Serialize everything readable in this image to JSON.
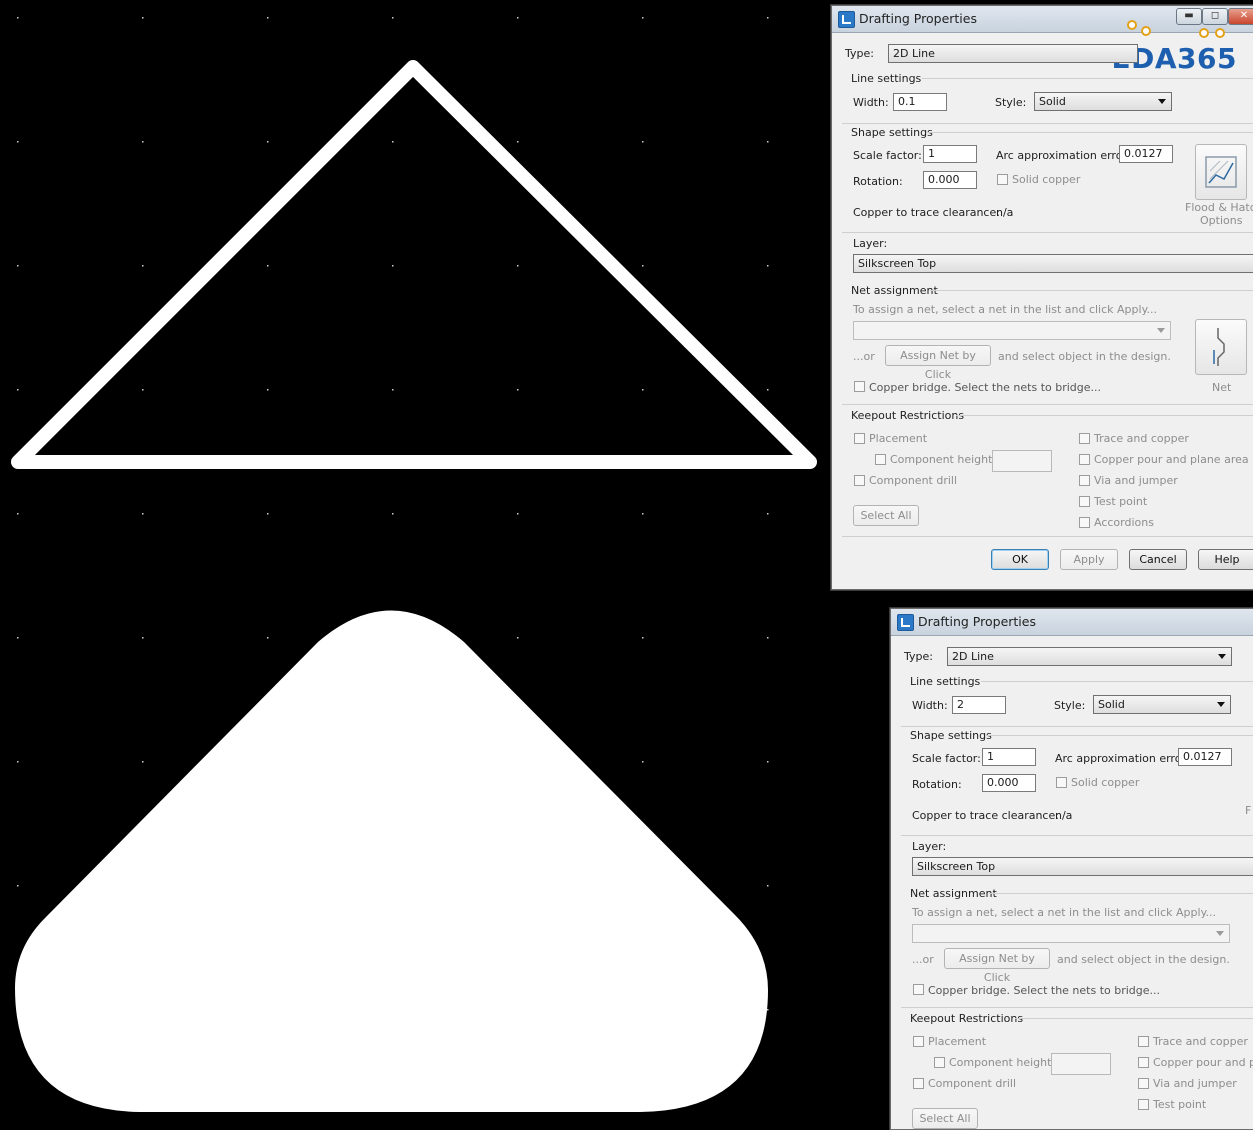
{
  "dialog_top": {
    "title": "Drafting Properties",
    "logo_text": "EDA365",
    "window_buttons": {
      "minimize": "▬",
      "maximize": "◻",
      "close": "✕"
    },
    "type_label": "Type:",
    "type_value": "2D Line",
    "line_settings": "Line settings",
    "width_label": "Width:",
    "width_value": "0.1",
    "style_label": "Style:",
    "style_value": "Solid",
    "shape_settings": "Shape settings",
    "scale_label": "Scale factor:",
    "scale_value": "1",
    "arc_label": "Arc approximation error:",
    "arc_value": "0.0127",
    "rotation_label": "Rotation:",
    "rotation_value": "0.000",
    "solid_copper": "Solid copper",
    "clearance_label": "Copper to trace clearance:",
    "clearance_value": "n/a",
    "flood_hatch_1": "Flood & Hatch",
    "flood_hatch_2": "Options",
    "layer_label": "Layer:",
    "layer_value": "Silkscreen Top",
    "net_assignment": "Net assignment",
    "net_hint": "To assign a net, select a net in the list and click Apply...",
    "or_text": "...or",
    "assign_net_button": "Assign Net by Click",
    "select_object_text": "and select object in the design.",
    "copper_bridge": "Copper bridge. Select the nets to bridge...",
    "net_label": "Net",
    "keepout": "Keepout Restrictions",
    "placement": "Placement",
    "component_height": "Component height",
    "component_drill": "Component drill",
    "trace_copper": "Trace and copper",
    "copper_pour": "Copper pour and plane area",
    "via_jumper": "Via and jumper",
    "test_point": "Test point",
    "accordions": "Accordions",
    "select_all": "Select All",
    "ok": "OK",
    "apply": "Apply",
    "cancel": "Cancel",
    "help": "Help"
  },
  "dialog_bottom": {
    "title": "Drafting Properties",
    "type_label": "Type:",
    "type_value": "2D Line",
    "line_settings": "Line settings",
    "width_label": "Width:",
    "width_value": "2",
    "style_label": "Style:",
    "style_value": "Solid",
    "shape_settings": "Shape settings",
    "scale_label": "Scale factor:",
    "scale_value": "1",
    "arc_label": "Arc approximation error:",
    "arc_value": "0.0127",
    "rotation_label": "Rotation:",
    "rotation_value": "0.000",
    "solid_copper": "Solid copper",
    "clearance_label": "Copper to trace clearance:",
    "clearance_value": "n/a",
    "side_letter": "F",
    "layer_label": "Layer:",
    "layer_value": "Silkscreen Top",
    "net_assignment": "Net assignment",
    "net_hint": "To assign a net, select a net in the list and click Apply...",
    "or_text": "...or",
    "assign_net_button": "Assign Net by Click",
    "select_object_text": "and select object in the design.",
    "copper_bridge": "Copper bridge. Select the nets to bridge...",
    "keepout": "Keepout Restrictions",
    "placement": "Placement",
    "component_height": "Component height",
    "component_drill": "Component drill",
    "trace_copper": "Trace and copper",
    "copper_pour": "Copper pour and pla",
    "via_jumper": "Via and jumper",
    "test_point": "Test point",
    "select_all": "Select All"
  },
  "colors": {
    "canvas": "#000000",
    "shape": "#ffffff",
    "grid_dot": "#cccccc"
  }
}
